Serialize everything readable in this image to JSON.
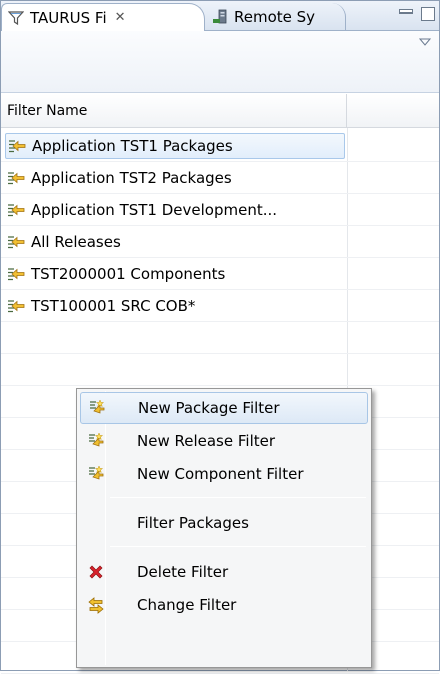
{
  "tabs": [
    {
      "label": "TAURUS Fi",
      "close": "✕"
    },
    {
      "label": "Remote Sy"
    }
  ],
  "table": {
    "columns": [
      "Filter Name",
      ""
    ],
    "rows": [
      {
        "label": "Application TST1 Packages"
      },
      {
        "label": "Application TST2 Packages"
      },
      {
        "label": "Application TST1 Development..."
      },
      {
        "label": "All Releases"
      },
      {
        "label": "TST2000001 Components"
      },
      {
        "label": "TST100001 SRC COB*"
      }
    ]
  },
  "context_menu": {
    "items": [
      {
        "label": "New Package Filter",
        "icon": "new-filter-icon"
      },
      {
        "label": "New Release Filter",
        "icon": "new-filter-icon"
      },
      {
        "label": "New Component Filter",
        "icon": "new-filter-icon"
      },
      {
        "label": "Filter Packages",
        "icon": ""
      },
      {
        "label": "Delete Filter",
        "icon": "delete-icon"
      },
      {
        "label": "Change Filter",
        "icon": "change-filter-icon"
      }
    ]
  },
  "colors": {
    "selection": "#dbe9f9",
    "delete_icon": "#d9232e",
    "arrow_icon": "#e0a020"
  }
}
